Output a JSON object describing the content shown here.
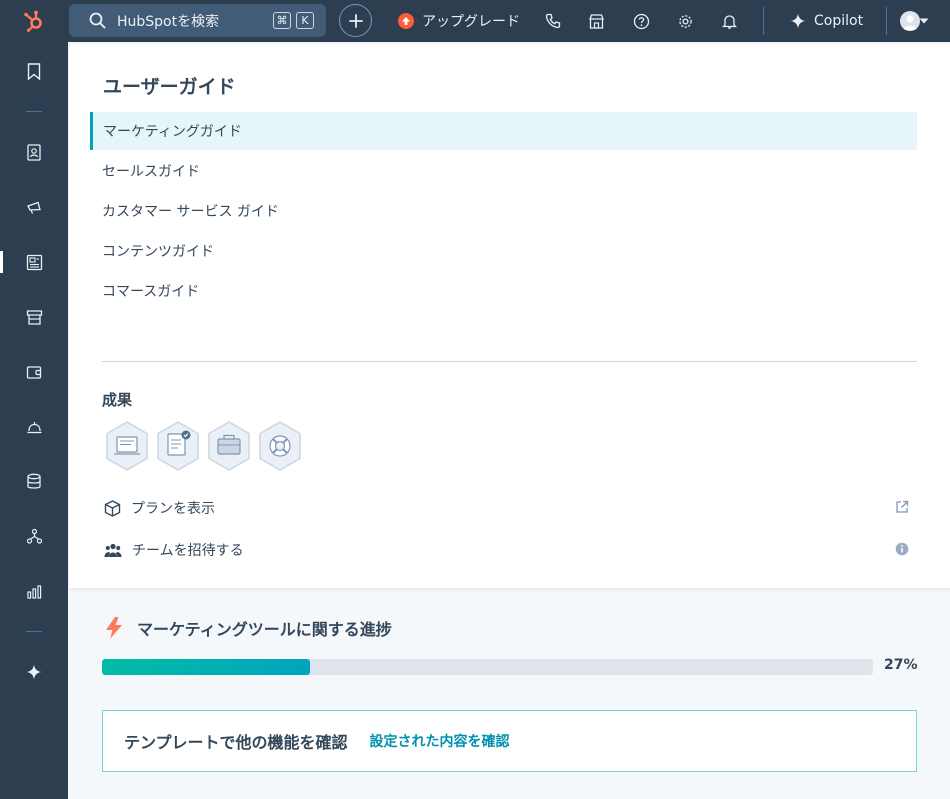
{
  "topbar": {
    "search_label": "HubSpotを検索",
    "shortcut_keys": [
      "⌘",
      "K"
    ],
    "upgrade_label": "アップグレード",
    "copilot_label": "Copilot"
  },
  "guide": {
    "title": "ユーザーガイド",
    "items": [
      {
        "label": "マーケティングガイド",
        "active": true
      },
      {
        "label": "セールスガイド",
        "active": false
      },
      {
        "label": "カスタマー サービス ガイド",
        "active": false
      },
      {
        "label": "コンテンツガイド",
        "active": false
      },
      {
        "label": "コマースガイド",
        "active": false
      }
    ]
  },
  "achievements": {
    "title": "成果",
    "badges": [
      "certificate-badge-icon",
      "checklist-badge-icon",
      "briefcase-badge-icon",
      "lifebuoy-badge-icon"
    ]
  },
  "links": {
    "plan_label": "プランを表示",
    "invite_label": "チームを招待する"
  },
  "progress": {
    "title": "マーケティングツールに関する進捗",
    "percent_label": "27%",
    "fraction": 0.27
  },
  "cta": {
    "text": "テンプレートで他の機能を確認",
    "link_label": "設定された内容を確認"
  },
  "colors": {
    "nav_bg": "#2d3e50",
    "accent_teal": "#00a4bd",
    "brand_orange": "#ff5c35",
    "link_blue": "#0091ae"
  }
}
